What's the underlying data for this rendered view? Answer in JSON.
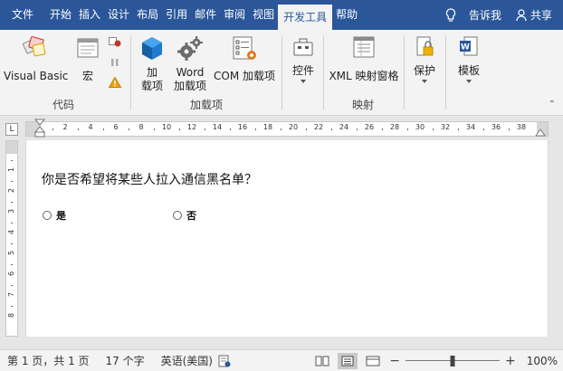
{
  "tabs": [
    "文件",
    "开始",
    "插入",
    "设计",
    "布局",
    "引用",
    "邮件",
    "审阅",
    "视图",
    "开发工具",
    "帮助"
  ],
  "active_tab": "开发工具",
  "tell_me": "告诉我",
  "share": "共享",
  "ribbon": {
    "code": {
      "label": "代码",
      "visual_basic": "Visual Basic",
      "macros": "宏"
    },
    "addins": {
      "label": "加载项",
      "addins_line1": "加",
      "addins_line2": "载项",
      "word_line1": "Word",
      "word_line2": "加载项",
      "com": "COM 加载项"
    },
    "controls": {
      "label": "控件"
    },
    "mapping": {
      "label": "映射",
      "xml": "XML 映射窗格"
    },
    "protect": {
      "label": "保护"
    },
    "templates": {
      "label": "模板"
    }
  },
  "ruler": {
    "corner": "L",
    "numbers": [
      "2",
      "4",
      "6",
      "8",
      "10",
      "12",
      "14",
      "16",
      "18",
      "20",
      "22",
      "24",
      "26",
      "28",
      "30",
      "32",
      "34",
      "36",
      "38"
    ],
    "vertical_numbers": [
      "1",
      "2",
      "3",
      "4",
      "5",
      "6",
      "7",
      "8"
    ]
  },
  "document": {
    "question": "你是否希望将某些人拉入通信黑名单？",
    "option_yes": "是",
    "option_no": "否"
  },
  "status": {
    "page": "第 1 页，共 1 页",
    "words": "17 个字",
    "language": "英语(美国)",
    "zoom": "100%",
    "zoom_minus": "−",
    "zoom_plus": "+",
    "zoom_level": 0.5
  },
  "colors": {
    "accent": "#2b579a",
    "macro_red": "#c0392b",
    "warning": "#f0a30a",
    "addin_blue": "#1e7bd0",
    "gear": "#6b6b6b",
    "orange": "#e07b20"
  }
}
